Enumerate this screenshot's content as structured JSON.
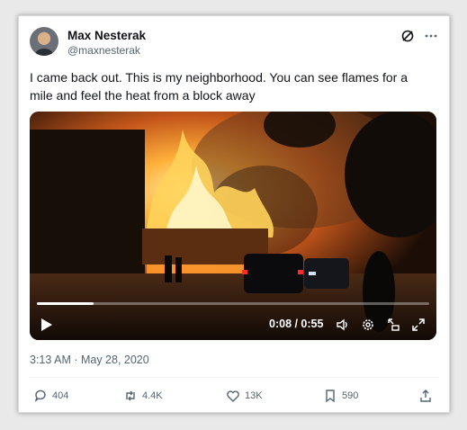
{
  "author": {
    "name": "Max Nesterak",
    "handle": "@maxnesterak"
  },
  "header_icons": [
    "grok-icon",
    "more-icon"
  ],
  "tweet": {
    "text": "I came back out. This is my neighborhood. You can see flames for a mile and feel the heat from a block away",
    "timestamp": "3:13 AM · May 28, 2020"
  },
  "video": {
    "elapsed": "0:08",
    "duration": "0:55",
    "time_label": "0:08 / 0:55",
    "progress": 0.145,
    "controls": [
      "play-icon",
      "volume-icon",
      "settings-icon",
      "picture-in-picture-icon",
      "fullscreen-icon"
    ]
  },
  "actions": {
    "replies": "404",
    "reposts": "4.4K",
    "likes": "13K",
    "bookmarks": "590"
  },
  "colors": {
    "text_primary": "#0f1419",
    "text_secondary": "#536471",
    "fire": "#ffb13b"
  }
}
